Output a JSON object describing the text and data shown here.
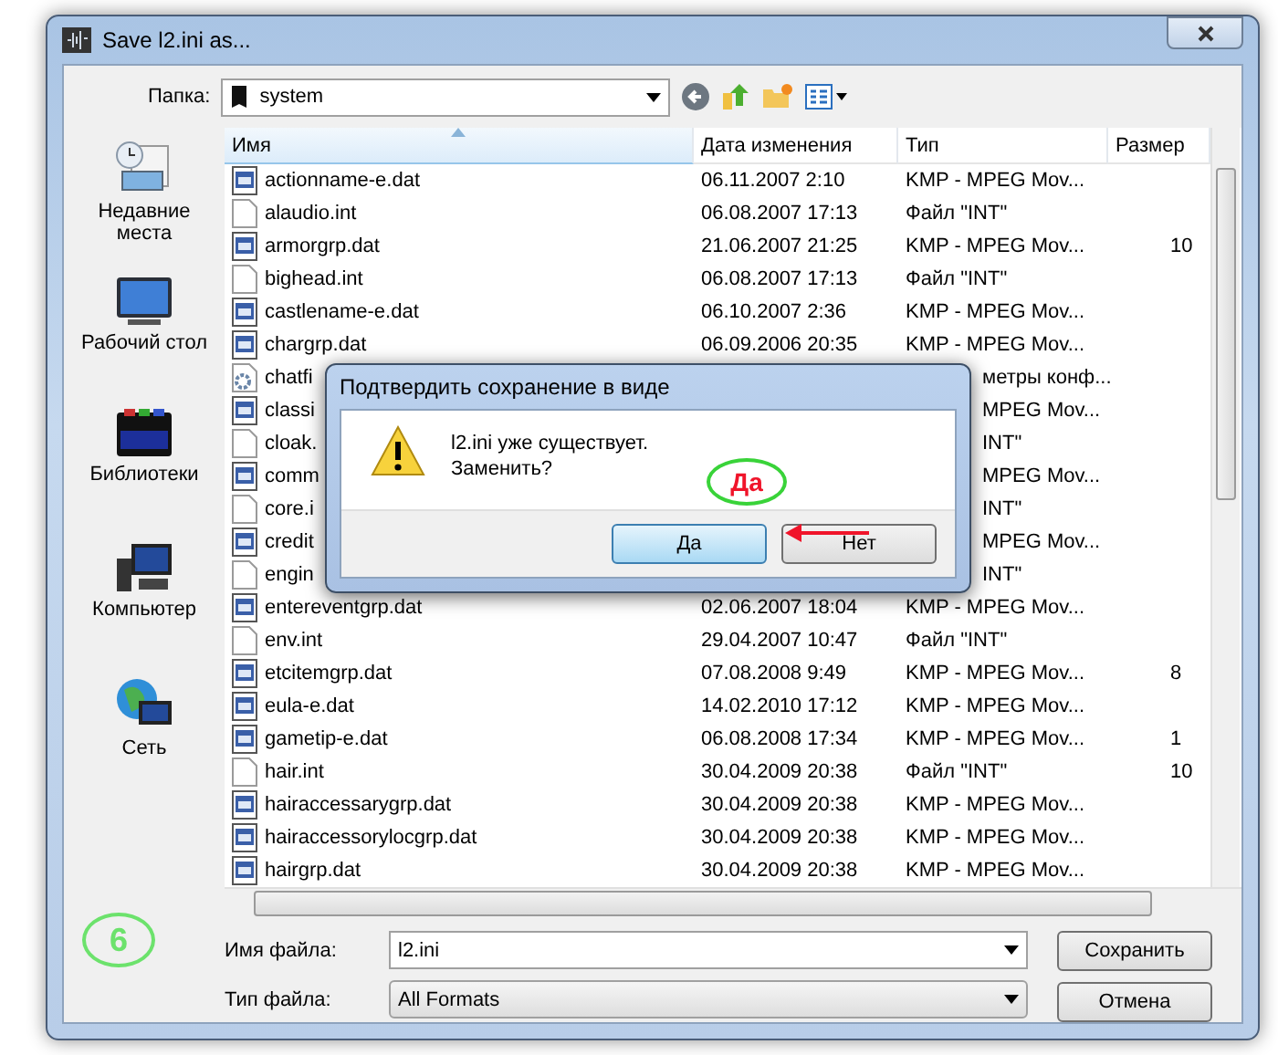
{
  "window": {
    "title": "Save l2.ini as..."
  },
  "location": {
    "label": "Папка:",
    "value": "system"
  },
  "sidebar": {
    "items": [
      {
        "label": "Недавние места",
        "kind": "recent"
      },
      {
        "label": "Рабочий стол",
        "kind": "desktop"
      },
      {
        "label": "Библиотеки",
        "kind": "libraries"
      },
      {
        "label": "Компьютер",
        "kind": "computer"
      },
      {
        "label": "Сеть",
        "kind": "network"
      }
    ]
  },
  "table": {
    "columns": [
      "Имя",
      "Дата изменения",
      "Тип",
      "Размер"
    ],
    "rows": [
      {
        "kind": "media",
        "name": "actionname-e.dat",
        "date": "06.11.2007 2:10",
        "type": "KMP - MPEG Mov..."
      },
      {
        "kind": "blank",
        "name": "alaudio.int",
        "date": "06.08.2007 17:13",
        "type": "Файл \"INT\""
      },
      {
        "kind": "media",
        "name": "armorgrp.dat",
        "date": "21.06.2007 21:25",
        "type": "KMP - MPEG Mov...",
        "size": "10"
      },
      {
        "kind": "blank",
        "name": "bighead.int",
        "date": "06.08.2007 17:13",
        "type": "Файл \"INT\""
      },
      {
        "kind": "media",
        "name": "castlename-e.dat",
        "date": "06.10.2007 2:36",
        "type": "KMP - MPEG Mov..."
      },
      {
        "kind": "media",
        "name": "chargrp.dat",
        "date": "06.09.2006 20:35",
        "type": "KMP - MPEG Mov..."
      },
      {
        "kind": "config",
        "name": "chatfi",
        "type": "метры конф..."
      },
      {
        "kind": "media",
        "name": "classi",
        "type": "MPEG Mov..."
      },
      {
        "kind": "blank",
        "name": "cloak.",
        "type": "INT\""
      },
      {
        "kind": "media",
        "name": "comm",
        "type": "MPEG Mov..."
      },
      {
        "kind": "blank",
        "name": "core.i",
        "type": "INT\""
      },
      {
        "kind": "media",
        "name": "credit",
        "type": "MPEG Mov..."
      },
      {
        "kind": "blank",
        "name": "engin",
        "type": "INT\""
      },
      {
        "kind": "media",
        "name": "entereventgrp.dat",
        "date": "02.06.2007 18:04",
        "type": "KMP - MPEG Mov..."
      },
      {
        "kind": "blank",
        "name": "env.int",
        "date": "29.04.2007 10:47",
        "type": "Файл \"INT\""
      },
      {
        "kind": "media",
        "name": "etcitemgrp.dat",
        "date": "07.08.2008 9:49",
        "type": "KMP - MPEG Mov...",
        "size": "8"
      },
      {
        "kind": "media",
        "name": "eula-e.dat",
        "date": "14.02.2010 17:12",
        "type": "KMP - MPEG Mov..."
      },
      {
        "kind": "media",
        "name": "gametip-e.dat",
        "date": "06.08.2008 17:34",
        "type": "KMP - MPEG Mov...",
        "size": "1"
      },
      {
        "kind": "blank",
        "name": "hair.int",
        "date": "30.04.2009 20:38",
        "type": "Файл \"INT\"",
        "size": "10"
      },
      {
        "kind": "media",
        "name": "hairaccessarygrp.dat",
        "date": "30.04.2009 20:38",
        "type": "KMP - MPEG Mov..."
      },
      {
        "kind": "media",
        "name": "hairaccessorylocgrp.dat",
        "date": "30.04.2009 20:38",
        "type": "KMP - MPEG Mov..."
      },
      {
        "kind": "media",
        "name": "hairgrp.dat",
        "date": "30.04.2009 20:38",
        "type": "KMP - MPEG Mov..."
      }
    ]
  },
  "filename": {
    "label": "Имя файла:",
    "value": "l2.ini"
  },
  "filetype": {
    "label": "Тип файла:",
    "value": "All Formats"
  },
  "buttons": [
    "Сохранить",
    "Отмена"
  ],
  "step_badge": "6",
  "confirm_dialog": {
    "title": "Подтвердить сохранение в виде",
    "message": "l2.ini уже существует.",
    "question": "Заменить?",
    "callout": "Да",
    "buttons": [
      {
        "label": "Да",
        "selected": true
      },
      {
        "label": "Нет",
        "selected": false
      }
    ]
  }
}
